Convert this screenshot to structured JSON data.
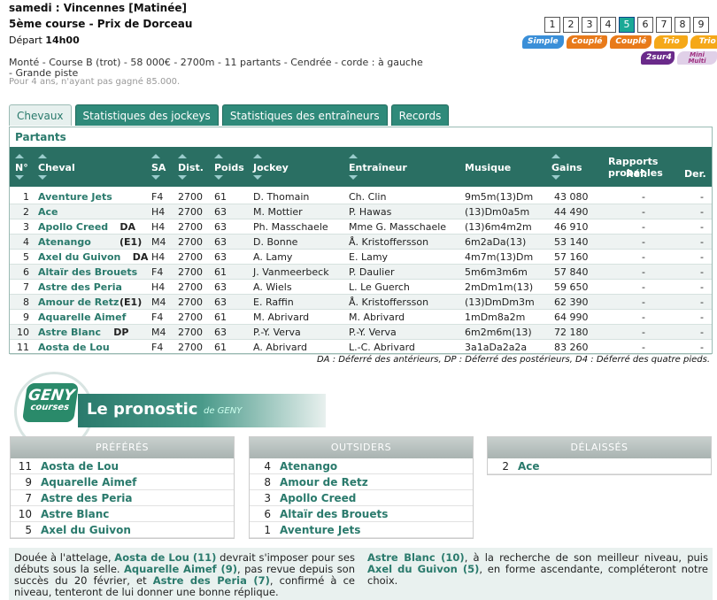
{
  "header": {
    "day_label": "samedi :",
    "venue": "Vincennes [Matinée]",
    "race_title": "5ème course - Prix de Dorceau",
    "depart_label": "Départ",
    "depart_time": "14h00"
  },
  "race_numbers": [
    "1",
    "2",
    "3",
    "4",
    "5",
    "6",
    "7",
    "8",
    "9"
  ],
  "active_race": "5",
  "bet_types_row1": [
    {
      "label": "Simple",
      "color": "#3a8fd8"
    },
    {
      "label": "Couplé",
      "color": "#e87a1a"
    },
    {
      "label": "Couplé",
      "color": "#e87a1a"
    },
    {
      "label": "Trio",
      "color": "#f5a818"
    },
    {
      "label": "Trio",
      "color": "#f5a818"
    }
  ],
  "bet_types_row2": [
    {
      "label": "2sur4",
      "color": "#6a2a8a"
    },
    {
      "label": "Mini Multi",
      "color": "#e0d0e8"
    }
  ],
  "race_info": {
    "line1": "Monté - Course B (trot) - 58 000€ - 2700m - 11 partants - Cendrée - corde : à gauche",
    "line2": "- Grande piste",
    "line3": "Pour 4 ans, n'ayant pas gagné 85.000."
  },
  "tabs": [
    "Chevaux",
    "Statistiques des jockeys",
    "Statistiques des entraîneurs",
    "Records"
  ],
  "partants": {
    "title": "Partants",
    "columns": {
      "num": "N°",
      "cheval": "Cheval",
      "sa": "SA",
      "dist": "Dist.",
      "poids": "Poids",
      "jockey": "Jockey",
      "entraineur": "Entraîneur",
      "musique": "Musique",
      "gains": "Gains",
      "rapports": "Rapports probables",
      "ref": "Réf.",
      "der": "Der."
    },
    "rows": [
      {
        "num": "1",
        "cheval": "Aventure Jets",
        "tag": "",
        "sa": "F4",
        "dist": "2700",
        "poids": "61",
        "jockey": "D. Thomain",
        "entraineur": "Ch. Clin",
        "musique": "9m5m(13)Dm",
        "gains": "43 080",
        "ref": "-",
        "der": "-"
      },
      {
        "num": "2",
        "cheval": "Ace",
        "tag": "",
        "sa": "H4",
        "dist": "2700",
        "poids": "63",
        "jockey": "M. Mottier",
        "entraineur": "P. Hawas",
        "musique": "(13)Dm0a5m",
        "gains": "44 490",
        "ref": "-",
        "der": "-"
      },
      {
        "num": "3",
        "cheval": "Apollo Creed",
        "tag": "DA",
        "sa": "H4",
        "dist": "2700",
        "poids": "63",
        "jockey": "Ph. Masschaele",
        "entraineur": "Mme G. Masschaele",
        "musique": "(13)6m4m2m",
        "gains": "46 910",
        "ref": "-",
        "der": "-"
      },
      {
        "num": "4",
        "cheval": "Atenango",
        "tag": "(E1)",
        "sa": "M4",
        "dist": "2700",
        "poids": "63",
        "jockey": "D. Bonne",
        "entraineur": "Å. Kristoffersson",
        "musique": "6m2aDa(13)",
        "gains": "53 140",
        "ref": "-",
        "der": "-"
      },
      {
        "num": "5",
        "cheval": "Axel du Guivon",
        "tag": "DA",
        "sa": "H4",
        "dist": "2700",
        "poids": "63",
        "jockey": "A. Lamy",
        "entraineur": "E. Lamy",
        "musique": "4m7m(13)Dm",
        "gains": "57 160",
        "ref": "-",
        "der": "-"
      },
      {
        "num": "6",
        "cheval": "Altaïr des Brouets",
        "tag": "",
        "sa": "F4",
        "dist": "2700",
        "poids": "61",
        "jockey": "J. Vanmeerbeck",
        "entraineur": "P. Daulier",
        "musique": "5m6m3m6m",
        "gains": "57 840",
        "ref": "-",
        "der": "-"
      },
      {
        "num": "7",
        "cheval": "Astre des Peria",
        "tag": "",
        "sa": "H4",
        "dist": "2700",
        "poids": "63",
        "jockey": "A. Wiels",
        "entraineur": "L. Le Guerch",
        "musique": "2mDm1m(13)",
        "gains": "59 650",
        "ref": "-",
        "der": "-"
      },
      {
        "num": "8",
        "cheval": "Amour de Retz",
        "tag": "(E1)",
        "sa": "M4",
        "dist": "2700",
        "poids": "63",
        "jockey": "E. Raffin",
        "entraineur": "Å. Kristoffersson",
        "musique": "(13)DmDm3m",
        "gains": "62 390",
        "ref": "-",
        "der": "-"
      },
      {
        "num": "9",
        "cheval": "Aquarelle Aimef",
        "tag": "",
        "sa": "F4",
        "dist": "2700",
        "poids": "61",
        "jockey": "M. Abrivard",
        "entraineur": "M. Abrivard",
        "musique": "1mDm8a2m",
        "gains": "64 990",
        "ref": "-",
        "der": "-"
      },
      {
        "num": "10",
        "cheval": "Astre Blanc",
        "tag": "DP",
        "sa": "M4",
        "dist": "2700",
        "poids": "63",
        "jockey": "P.-Y. Verva",
        "entraineur": "P.-Y. Verva",
        "musique": "6m2m6m(13)",
        "gains": "72 180",
        "ref": "-",
        "der": "-"
      },
      {
        "num": "11",
        "cheval": "Aosta de Lou",
        "tag": "",
        "sa": "F4",
        "dist": "2700",
        "poids": "61",
        "jockey": "A. Abrivard",
        "entraineur": "L.-C. Abrivard",
        "musique": "3a1aDa2a2a",
        "gains": "83 260",
        "ref": "-",
        "der": "-"
      }
    ],
    "legend": "DA : Déferré des antérieurs, DP : Déferré des postérieurs, D4 : Déferré des quatre pieds."
  },
  "pronostic": {
    "logo_top": "GENY",
    "logo_bottom": "courses",
    "title": "Le pronostic",
    "subtitle": "de GENY",
    "panels": [
      {
        "title": "PRÉFÉRÉS",
        "items": [
          {
            "n": "11",
            "h": "Aosta de Lou"
          },
          {
            "n": "9",
            "h": "Aquarelle Aimef"
          },
          {
            "n": "7",
            "h": "Astre des Peria"
          },
          {
            "n": "10",
            "h": "Astre Blanc"
          },
          {
            "n": "5",
            "h": "Axel du Guivon"
          }
        ]
      },
      {
        "title": "OUTSIDERS",
        "items": [
          {
            "n": "4",
            "h": "Atenango"
          },
          {
            "n": "8",
            "h": "Amour de Retz"
          },
          {
            "n": "3",
            "h": "Apollo Creed"
          },
          {
            "n": "6",
            "h": "Altaïr des Brouets"
          },
          {
            "n": "1",
            "h": "Aventure Jets"
          }
        ]
      },
      {
        "title": "DÉLAISSÉS",
        "items": [
          {
            "n": "2",
            "h": "Ace"
          }
        ]
      }
    ],
    "comment_left": [
      {
        "t": "Douée à l'attelage, "
      },
      {
        "b": "Aosta de Lou (11)"
      },
      {
        "t": " devrait s'imposer pour ses débuts sous la selle. "
      },
      {
        "b": "Aquarelle Aimef (9)"
      },
      {
        "t": ", pas revue depuis son succès du 20 février, et "
      },
      {
        "b": "Astre des Peria (7)"
      },
      {
        "t": ", confirmé à ce niveau, tenteront de lui donner une bonne réplique."
      }
    ],
    "comment_right": [
      {
        "b": "Astre Blanc (10)"
      },
      {
        "t": ", à la recherche de son meilleur niveau, puis "
      },
      {
        "b": "Axel du Guivon (5)"
      },
      {
        "t": ", en forme ascendante, compléteront notre choix."
      }
    ]
  }
}
